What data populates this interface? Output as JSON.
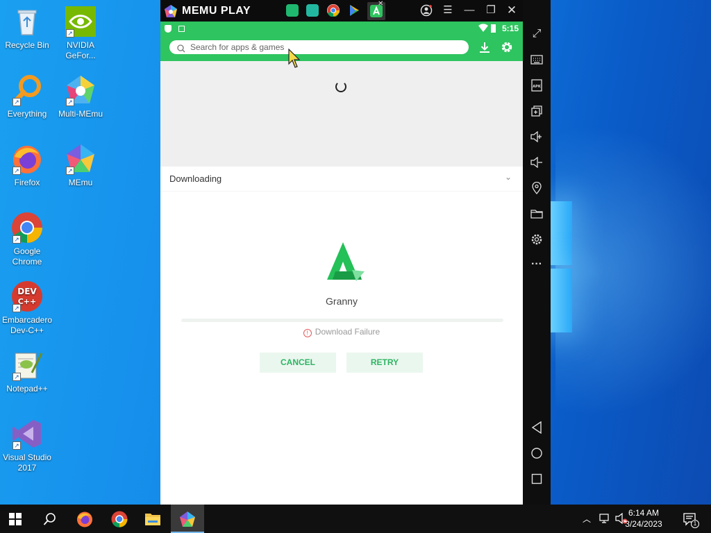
{
  "desktop": {
    "icons": [
      {
        "label": "Recycle Bin"
      },
      {
        "label": "NVIDIA GeFor..."
      },
      {
        "label": "Everything"
      },
      {
        "label": "Multi-MEmu"
      },
      {
        "label": "Firefox"
      },
      {
        "label": "MEmu"
      },
      {
        "label": "Google Chrome"
      },
      {
        "label": "Embarcadero Dev-C++"
      },
      {
        "label": "Notepad++"
      },
      {
        "label": "Visual Studio 2017"
      }
    ]
  },
  "memu": {
    "brand": "MEMU PLAY",
    "status_time": "5:15",
    "search_placeholder": "Search for apps & games",
    "section_title": "Downloading",
    "app_name": "Granny",
    "status_text": "Download Failure",
    "cancel_label": "CANCEL",
    "retry_label": "RETRY",
    "colors": {
      "accent": "#2ec45f",
      "button_text": "#2fb463",
      "button_bg": "#eaf7ef"
    }
  },
  "taskbar": {
    "time": "6:14 AM",
    "date": "3/24/2023",
    "notification_count": "1"
  }
}
